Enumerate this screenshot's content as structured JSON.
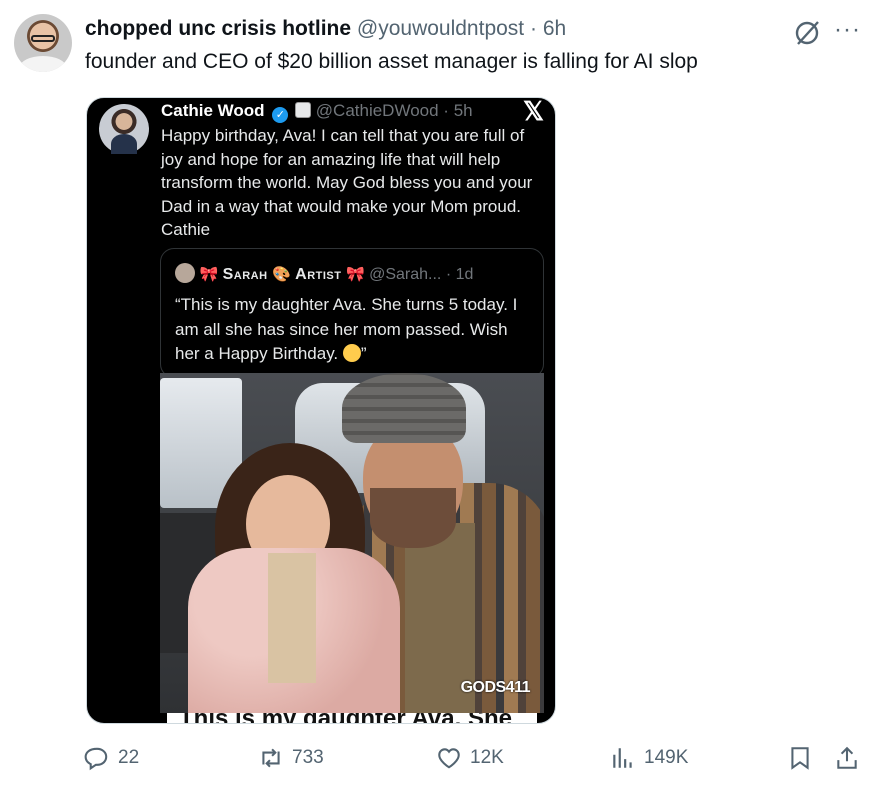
{
  "post": {
    "display_name": "chopped unc crisis hotline",
    "handle": "@youwouldntpost",
    "separator": "·",
    "time": "6h",
    "text": "founder and CEO of $20 billion asset manager is falling for AI slop"
  },
  "embedded": {
    "display_name": "Cathie Wood",
    "handle": "@CathieDWood",
    "separator": "·",
    "time": "5h",
    "text": "Happy birthday, Ava! I can tell that you are full of joy and hope for an amazing life that will help transform the world. May God bless you and your Dad in a way that would make your Mom proud. Cathie",
    "quote": {
      "display_name": "Sarah",
      "name_suffix": "Artist",
      "handle": "@Sarah...",
      "separator": "·",
      "time": "1d",
      "text": "“This is my daughter Ava. She turns 5 today. I am all she has since her mom passed. Wish her a Happy Birthday.",
      "text_end": "”"
    },
    "watermark": "GODS411",
    "caption_fragment": "This is my daughter Ava. She"
  },
  "actions": {
    "replies": "22",
    "reposts": "733",
    "likes": "12K",
    "views": "149K"
  },
  "icons": [
    "reply-icon",
    "repost-icon",
    "like-icon",
    "views-icon",
    "bookmark-icon",
    "share-icon",
    "grok-icon",
    "more-icon",
    "verified-icon",
    "x-logo-icon"
  ],
  "colors": {
    "text": "#0f1419",
    "secondary": "#536471",
    "verified": "#1d9bf0"
  }
}
